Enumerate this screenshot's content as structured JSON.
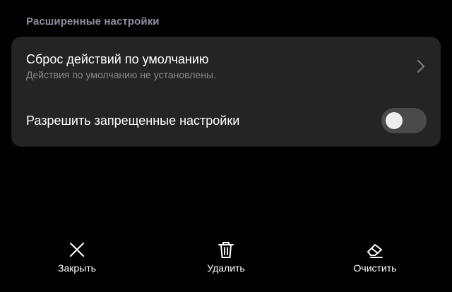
{
  "section": {
    "header": "Расширенные настройки"
  },
  "card": {
    "reset_defaults": {
      "title": "Сброс действий по умолчанию",
      "subtitle": "Действия по умолчанию не установлены.",
      "icon": "chevron-right-icon"
    },
    "allow_restricted": {
      "title": "Разрешить запрещенные настройки",
      "toggle_state": "off"
    }
  },
  "bottom_bar": {
    "close_label": "Закрыть",
    "delete_label": "Удалить",
    "clear_label": "Очистить",
    "close_icon": "close-icon",
    "delete_icon": "trash-icon",
    "clear_icon": "eraser-icon"
  },
  "colors": {
    "background": "#000000",
    "card": "#242424",
    "section_header": "#8e8fa0",
    "subtitle": "#8a8a8a",
    "toggle_track": "#4a4a4a",
    "toggle_knob": "#eeeeee"
  }
}
